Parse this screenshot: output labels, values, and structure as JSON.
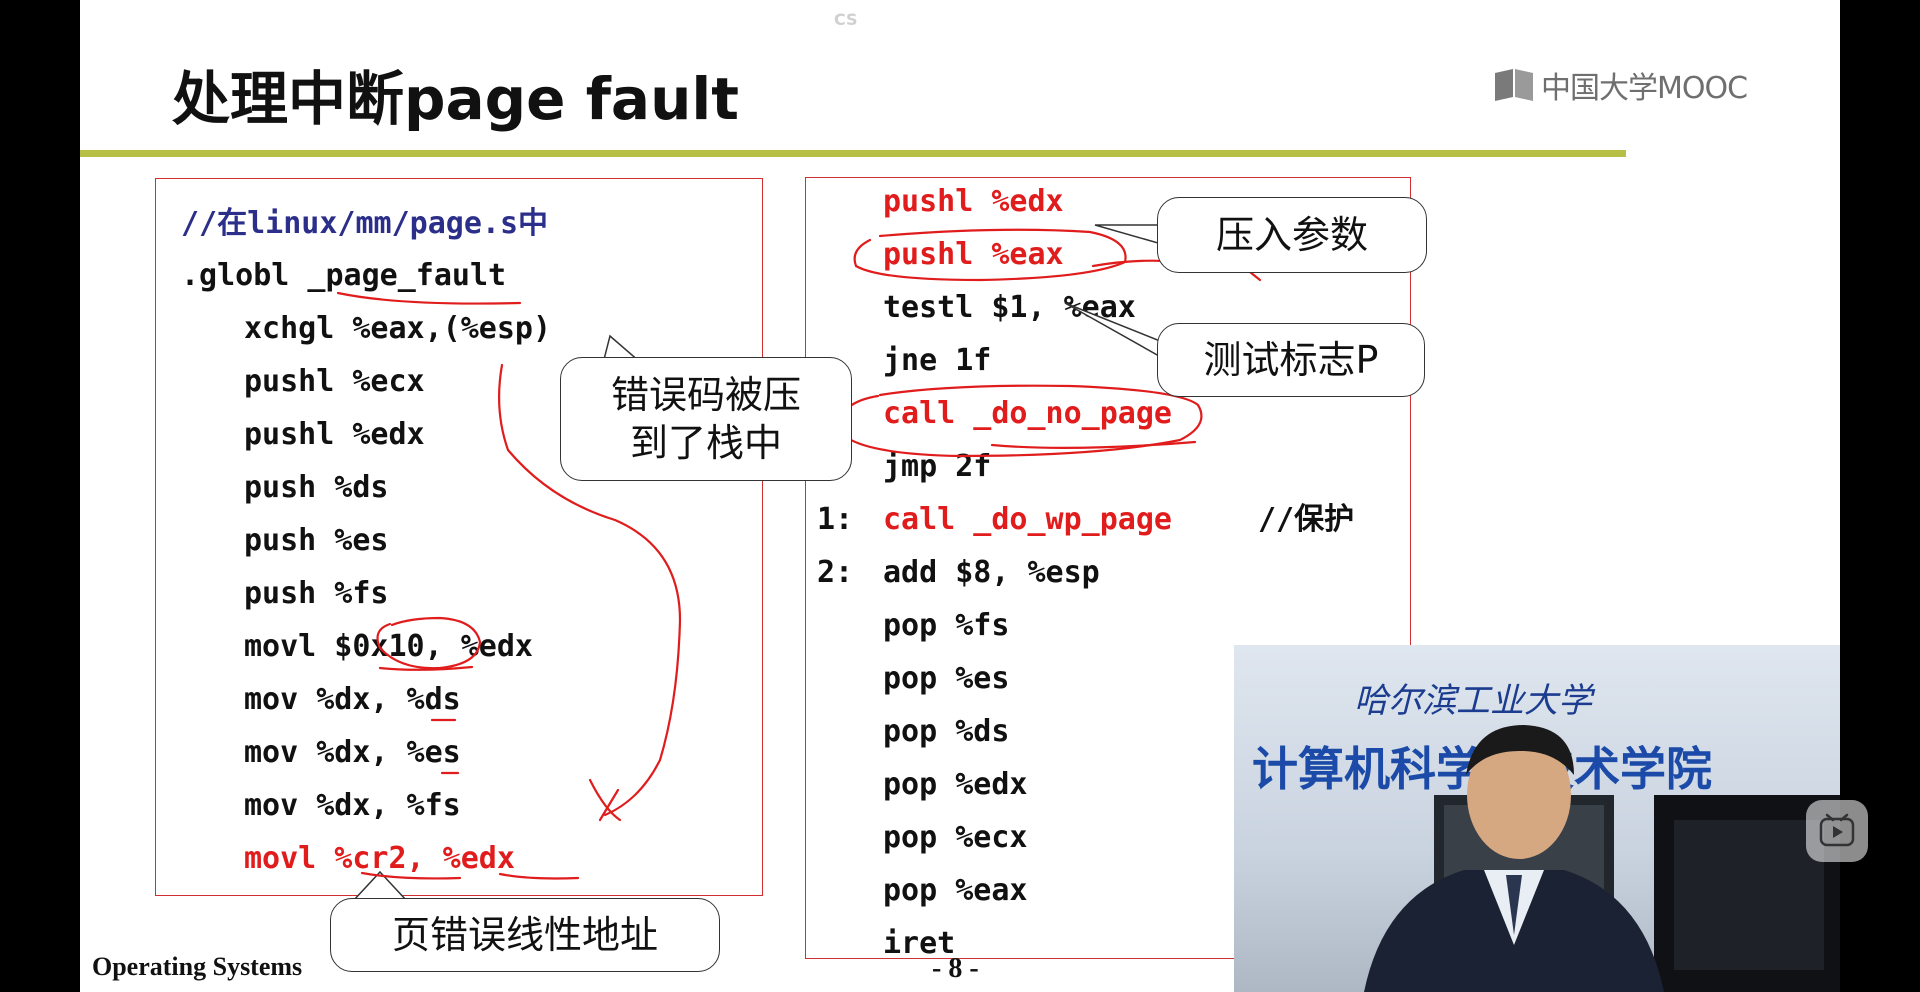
{
  "slide": {
    "title": "处理中断page fault",
    "watermark": "CS",
    "logo_text": "中国大学MOOC",
    "footer_left": "Operating Systems",
    "page_number": "- 8 -"
  },
  "left_code": {
    "comment": "//在linux/mm/page.s中",
    "lines": [
      ".globl _page_fault",
      "xchgl %eax,(%esp)",
      "pushl %ecx",
      "pushl %edx",
      "push %ds",
      "push %es",
      "push %fs",
      "movl $0x10, %edx",
      "mov %dx, %ds",
      "mov %dx, %es",
      "mov %dx, %fs",
      "movl %cr2, %edx"
    ]
  },
  "right_code": {
    "lines": [
      "pushl %edx",
      "pushl %eax",
      "testl $1, %eax",
      "jne 1f",
      "call _do_no_page",
      "jmp 2f",
      "1: call _do_wp_page //保护",
      "2: add $8, %esp",
      "pop %fs",
      "pop %es",
      "pop %ds",
      "pop %edx",
      "pop %ecx",
      "pop %eax",
      "iret"
    ],
    "line1_label": "1:",
    "line1_code": "call _do_wp_page",
    "line1_comment": "//保护",
    "line2_label": "2:",
    "line2_code": "add $8, %esp"
  },
  "callouts": {
    "error_code_pushed": "错误码被压\n到了栈中",
    "fault_linear_address": "页错误线性地址",
    "push_args": "压入参数",
    "test_flag_p": "测试标志P"
  },
  "video": {
    "wall_text_top": "哈尔滨工业大学",
    "wall_text_bottom": "计算机科学与技术学院"
  },
  "colors": {
    "code_red": "#e01c1c",
    "comment_blue": "#2c2f8a",
    "title_rule": "#b7bf45",
    "box_border": "#d23030"
  }
}
